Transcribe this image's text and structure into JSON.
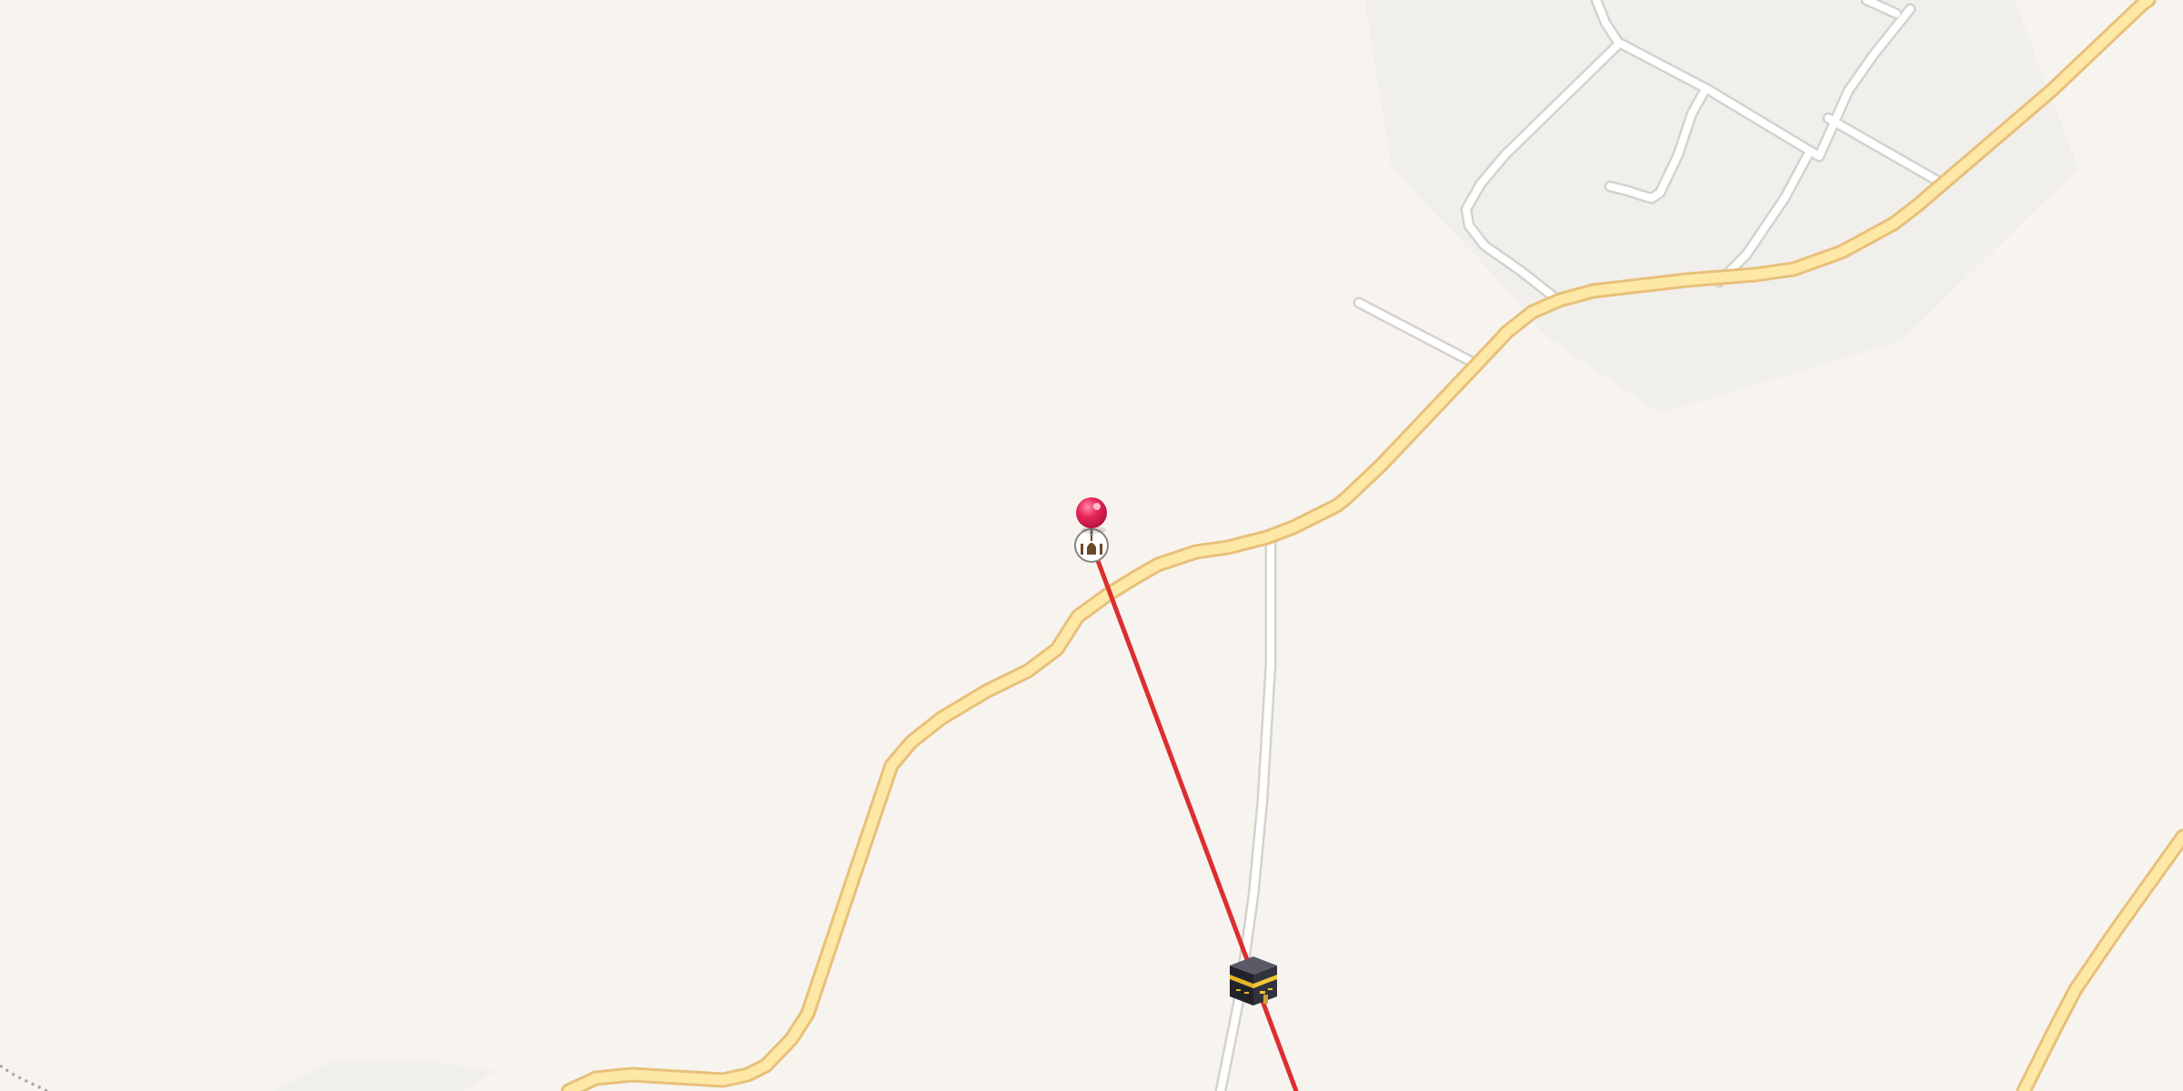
{
  "map": {
    "colors": {
      "background": "#f7f4f0",
      "urban_area": "#f1efec",
      "major_road_fill": "#fde8a6",
      "major_road_casing": "#e8c07a",
      "minor_road_fill": "#ffffff",
      "minor_road_casing": "#d5d2cd",
      "route_line": "#dc2e2e",
      "pin": "#e8275a",
      "boundary": "#a8a39c"
    },
    "markers": [
      {
        "id": "dropped-pin",
        "icon": "red-pushpin-icon",
        "kind": "location pin"
      },
      {
        "id": "mosque",
        "icon": "mosque-icon",
        "kind": "place of worship"
      },
      {
        "id": "kaaba",
        "icon": "kaaba-icon",
        "kind": "destination"
      }
    ],
    "route": {
      "style": "straight line",
      "from": "mosque",
      "to": "kaaba"
    }
  }
}
